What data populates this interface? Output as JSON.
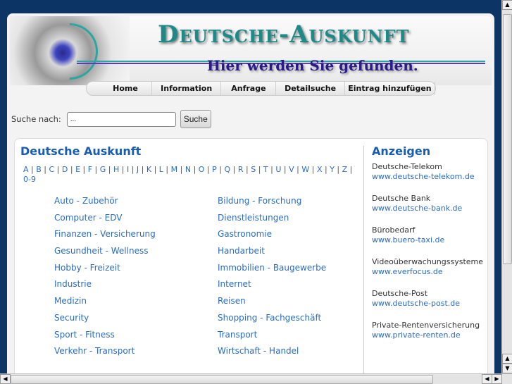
{
  "header": {
    "logo": "Deutsche-Auskunft",
    "slogan": "Hier werden Sie gefunden."
  },
  "nav": [
    "Home",
    "Information",
    "Anfrage",
    "Detailsuche",
    "Eintrag hinzufügen"
  ],
  "search": {
    "label": "Suche nach:",
    "value": "...",
    "button": "Suche"
  },
  "main": {
    "title": "Deutsche Auskunft",
    "alphabet": [
      "A",
      "B",
      "C",
      "D",
      "E",
      "F",
      "G",
      "H",
      "I",
      "J",
      "K",
      "L",
      "M",
      "N",
      "O",
      "P",
      "Q",
      "R",
      "S",
      "T",
      "U",
      "V",
      "W",
      "X",
      "Y",
      "Z",
      "0-9"
    ],
    "categories": [
      "Auto - Zubehör",
      "Bildung - Forschung",
      "Computer - EDV",
      "Dienstleistungen",
      "Finanzen - Versicherung",
      "Gastronomie",
      "Gesundheit - Wellness",
      "Handarbeit",
      "Hobby - Freizeit",
      "Immobilien - Baugewerbe",
      "Industrie",
      "Internet",
      "Medizin",
      "Reisen",
      "Security",
      "Shopping - Fachgeschäft",
      "Sport - Fitness",
      "Transport",
      "Verkehr - Transport",
      "Wirtschaft - Handel"
    ]
  },
  "ads": {
    "title": "Anzeigen",
    "items": [
      {
        "name": "Deutsche-Telekom",
        "url": "www.deutsche-telekom.de"
      },
      {
        "name": "Deutsche Bank",
        "url": "www.deutsche-bank.de"
      },
      {
        "name": "Bürobedarf",
        "url": "www.buero-taxi.de"
      },
      {
        "name": "Videoüberwachungssysteme",
        "url": "www.everfocus.de"
      },
      {
        "name": "Deutsche-Post",
        "url": "www.deutsche-post.de"
      },
      {
        "name": "Private-Rentenversicherung",
        "url": "www.private-renten.de"
      }
    ]
  }
}
